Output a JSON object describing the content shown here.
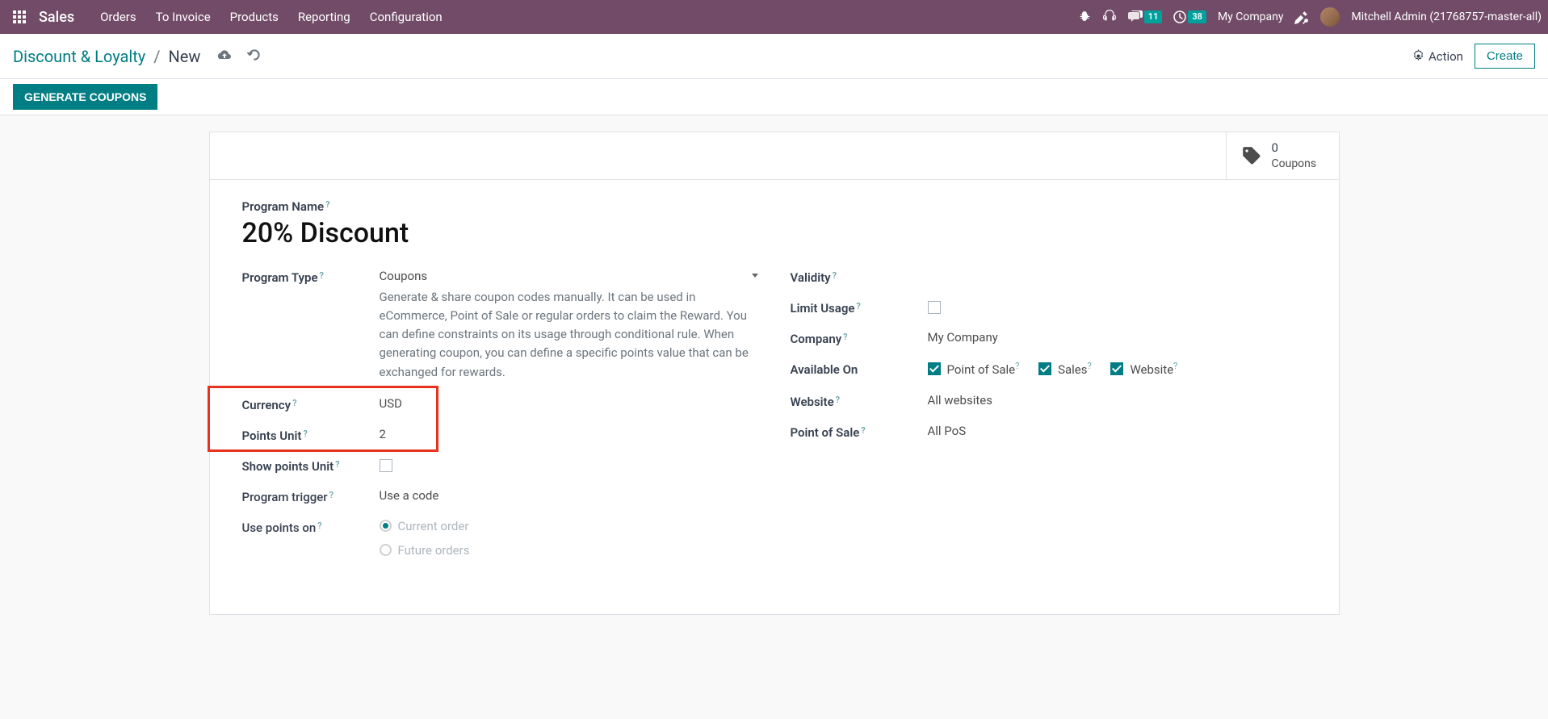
{
  "topbar": {
    "brand": "Sales",
    "menu": [
      "Orders",
      "To Invoice",
      "Products",
      "Reporting",
      "Configuration"
    ],
    "messages_badge": "11",
    "activities_badge": "38",
    "company": "My Company",
    "user": "Mitchell Admin (21768757-master-all)"
  },
  "breadcrumb": {
    "parent": "Discount & Loyalty",
    "current": "New",
    "action_label": "Action",
    "create_label": "Create"
  },
  "statusbar": {
    "generate_label": "GENERATE COUPONS"
  },
  "stat": {
    "coupons_count": "0",
    "coupons_label": "Coupons"
  },
  "form": {
    "program_name_label": "Program Name",
    "program_name_value": "20% Discount",
    "left": {
      "program_type_label": "Program Type",
      "program_type_value": "Coupons",
      "program_type_help": "Generate & share coupon codes manually. It can be used in eCommerce, Point of Sale or regular orders to claim the Reward. You can define constraints on its usage through conditional rule. When generating coupon, you can define a specific points value that can be exchanged for rewards.",
      "currency_label": "Currency",
      "currency_value": "USD",
      "points_unit_label": "Points Unit",
      "points_unit_value": "2",
      "show_points_label": "Show points Unit",
      "program_trigger_label": "Program trigger",
      "program_trigger_value": "Use a code",
      "use_points_label": "Use points on",
      "use_points_opt1": "Current order",
      "use_points_opt2": "Future orders"
    },
    "right": {
      "validity_label": "Validity",
      "limit_usage_label": "Limit Usage",
      "company_label": "Company",
      "company_value": "My Company",
      "available_on_label": "Available On",
      "pos_label": "Point of Sale",
      "sales_label": "Sales",
      "website_label_cb": "Website",
      "website_label": "Website",
      "website_placeholder": "All websites",
      "pos_field_label": "Point of Sale",
      "pos_placeholder": "All PoS"
    }
  }
}
